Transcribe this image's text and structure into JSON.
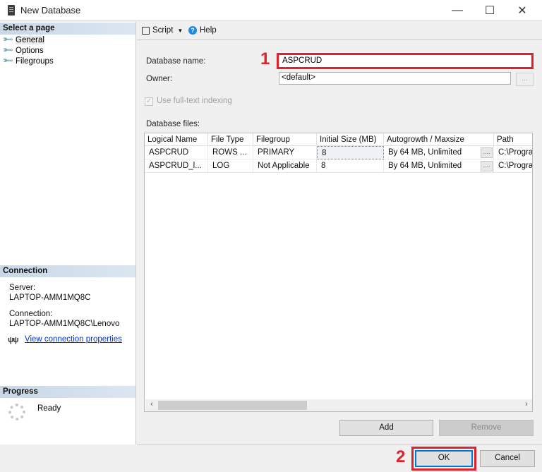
{
  "window": {
    "title": "New Database",
    "icon": "database-server-icon",
    "controls": {
      "minimize": "—",
      "maximize": "☐",
      "close": "✕"
    }
  },
  "sidebar": {
    "select_page_header": "Select a page",
    "pages": [
      {
        "label": "General",
        "icon": "wrench-icon",
        "selected": true
      },
      {
        "label": "Options",
        "icon": "wrench-icon",
        "selected": false
      },
      {
        "label": "Filegroups",
        "icon": "wrench-icon",
        "selected": false
      }
    ],
    "connection_header": "Connection",
    "server_label": "Server:",
    "server_value": "LAPTOP-AMM1MQ8C",
    "connection_label": "Connection:",
    "connection_value": "LAPTOP-AMM1MQ8C\\Lenovo",
    "view_connection_link": "View connection properties",
    "progress_header": "Progress",
    "progress_status": "Ready"
  },
  "toolbar": {
    "script_label": "Script",
    "dropdown_glyph": "▼",
    "help_label": "Help",
    "help_glyph": "?"
  },
  "form": {
    "database_name_label": "Database name:",
    "database_name_value": "ASPCRUD",
    "owner_label": "Owner:",
    "owner_value": "<default>",
    "browse_label": "...",
    "fulltext_label": "Use full-text indexing",
    "fulltext_checked": true,
    "fulltext_enabled": false,
    "database_files_label": "Database files:"
  },
  "annotations": {
    "step1": "1",
    "step2": "2",
    "highlight_color": "#e0202a"
  },
  "files_table": {
    "columns": [
      "Logical Name",
      "File Type",
      "Filegroup",
      "Initial Size (MB)",
      "Autogrowth / Maxsize",
      "Path"
    ],
    "rows": [
      {
        "logical_name": "ASPCRUD",
        "file_type": "ROWS ...",
        "filegroup": "PRIMARY",
        "initial_size": "8",
        "autogrowth": "By 64 MB, Unlimited",
        "autogrowth_btn": "....",
        "path": "C:\\Progra"
      },
      {
        "logical_name": "ASPCRUD_l...",
        "file_type": "LOG",
        "filegroup": "Not Applicable",
        "initial_size": "8",
        "autogrowth": "By 64 MB, Unlimited",
        "autogrowth_btn": "....",
        "path": "C:\\Progra"
      }
    ],
    "scroll_left": "‹",
    "scroll_right": "›"
  },
  "buttons": {
    "add": "Add",
    "remove": "Remove",
    "ok": "OK",
    "cancel": "Cancel"
  }
}
